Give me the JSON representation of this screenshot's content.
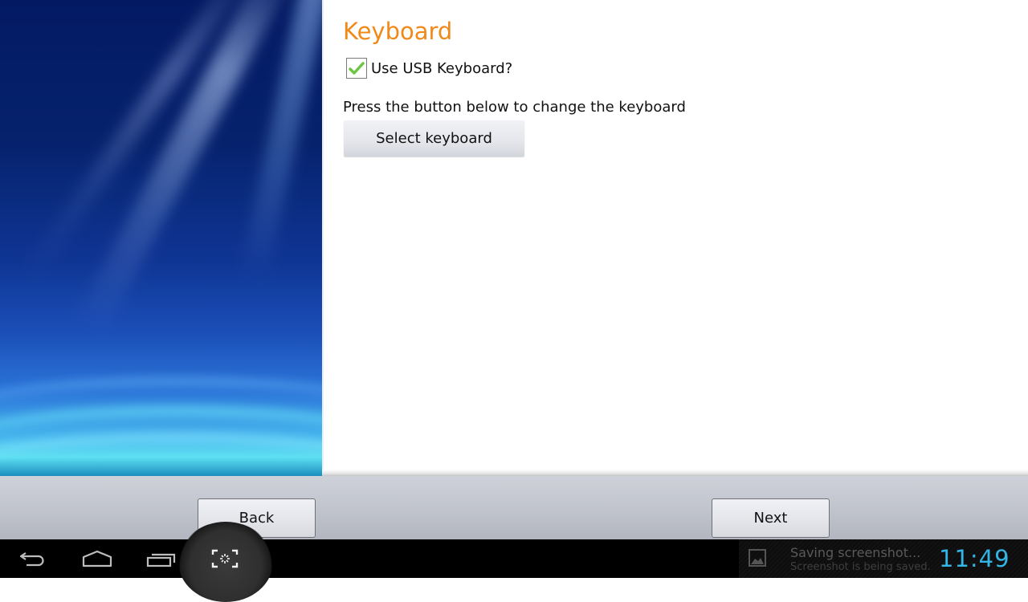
{
  "page": {
    "title": "Keyboard",
    "use_usb_keyboard": {
      "label": "Use USB Keyboard?",
      "checked": true
    },
    "hint": "Press the button below to change the keyboard",
    "select_keyboard_label": "Select keyboard"
  },
  "footer": {
    "back_label": "Back",
    "next_label": "Next"
  },
  "system_bar": {
    "icons": [
      "back-icon",
      "home-icon",
      "recent-apps-icon",
      "screenshot-icon"
    ],
    "notification": {
      "icon": "image-icon",
      "title": "Saving screenshot...",
      "subtitle": "Screenshot is being saved."
    },
    "clock": "11:49"
  },
  "colors": {
    "title_accent": "#f0891a",
    "clock": "#33b5e5",
    "check_mark": "#6cc644"
  }
}
